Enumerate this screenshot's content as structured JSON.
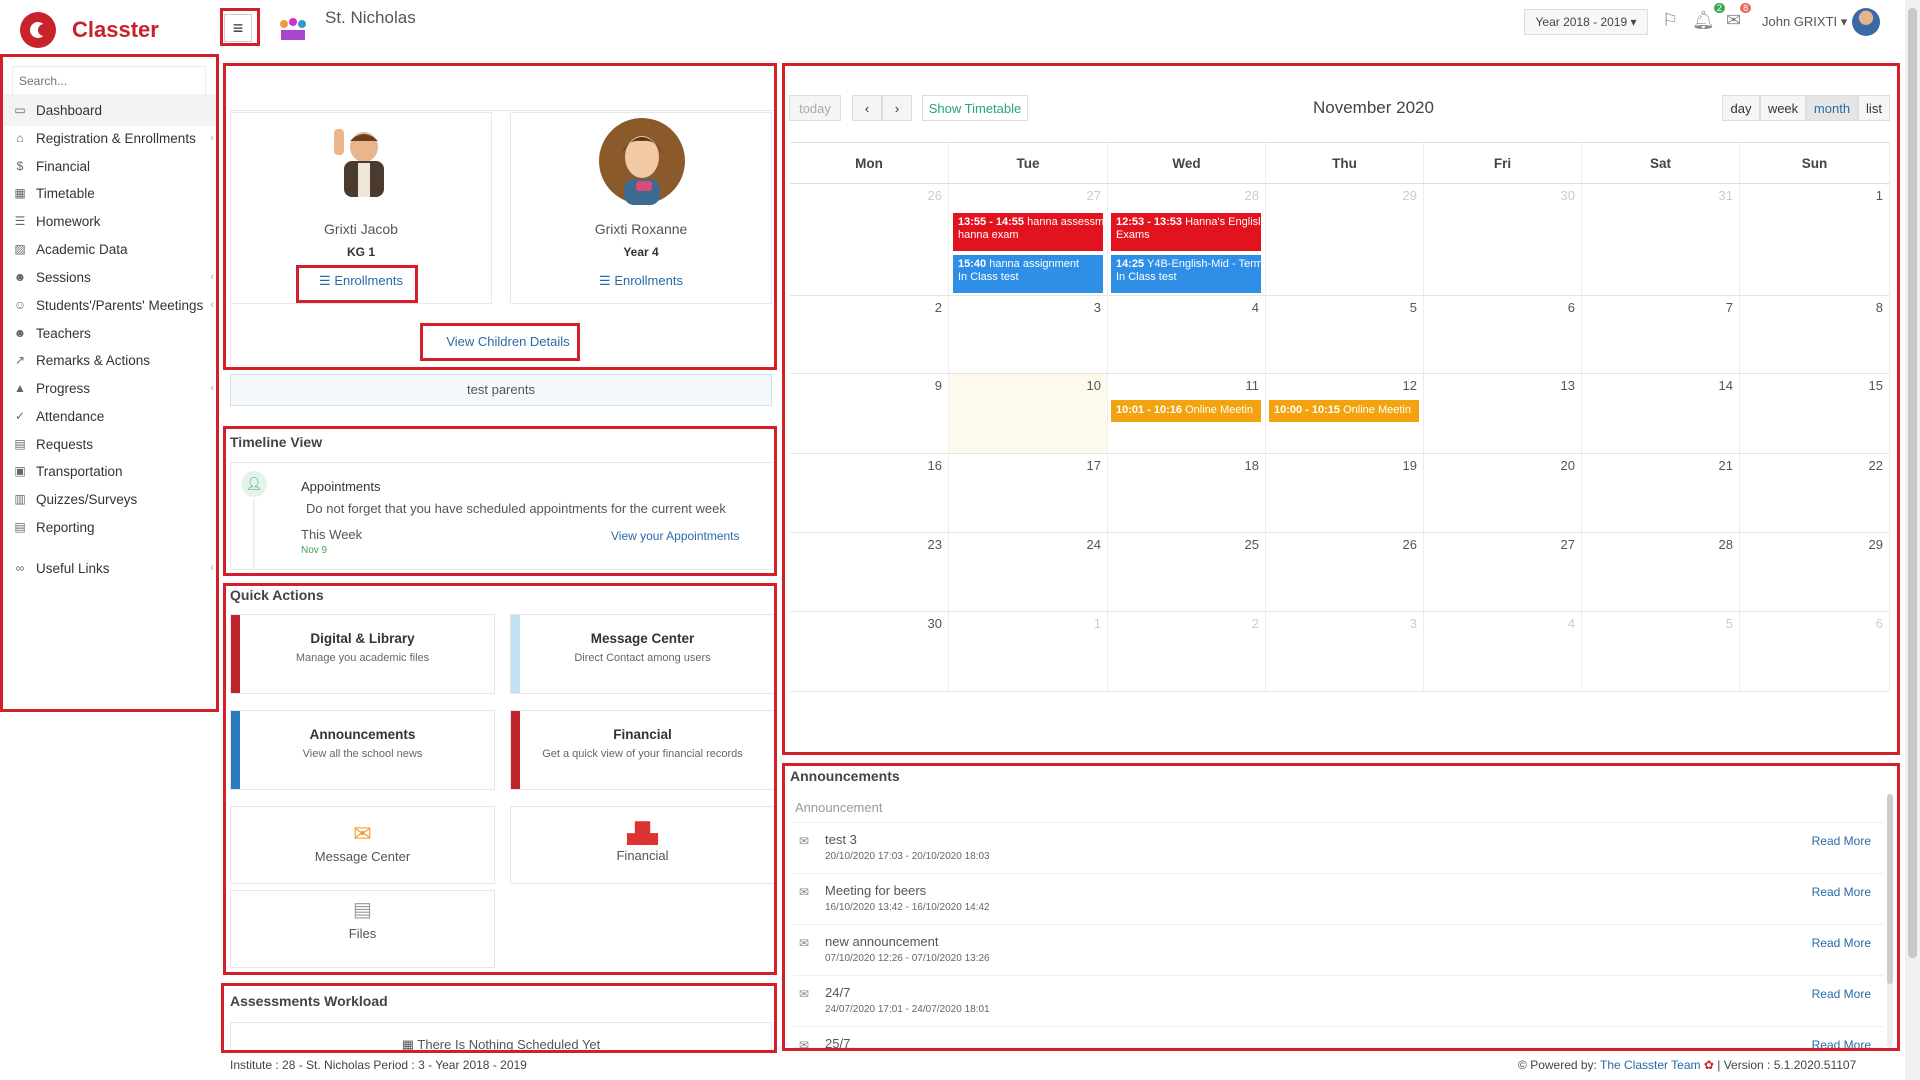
{
  "app": {
    "name": "Classter",
    "school": "St. Nicholas",
    "year": "Year 2018 - 2019 ▾",
    "user": "John GRIXTI ▾",
    "notif_count": "2",
    "mail_count": "8"
  },
  "search": {
    "placeholder": "Search..."
  },
  "sidebar": {
    "items": [
      {
        "label": "Dashboard",
        "icon": "monitor-icon"
      },
      {
        "label": "Registration & Enrollments",
        "icon": "bank-icon"
      },
      {
        "label": "Financial",
        "icon": "money-icon"
      },
      {
        "label": "Timetable",
        "icon": "calendar-icon"
      },
      {
        "label": "Homework",
        "icon": "list-icon"
      },
      {
        "label": "Academic Data",
        "icon": "chart-icon"
      },
      {
        "label": "Sessions",
        "icon": "users-icon"
      },
      {
        "label": "Students'/Parents' Meetings",
        "icon": "meeting-icon"
      },
      {
        "label": "Teachers",
        "icon": "teachers-icon"
      },
      {
        "label": "Remarks & Actions",
        "icon": "trend-icon"
      },
      {
        "label": "Progress",
        "icon": "graduation-icon"
      },
      {
        "label": "Attendance",
        "icon": "attendance-icon"
      },
      {
        "label": "Requests",
        "icon": "document-icon"
      },
      {
        "label": "Transportation",
        "icon": "bus-icon"
      },
      {
        "label": "Quizzes/Surveys",
        "icon": "quiz-icon"
      },
      {
        "label": "Reporting",
        "icon": "printer-icon"
      },
      {
        "label": "Useful Links",
        "icon": "link-icon"
      }
    ]
  },
  "children": [
    {
      "name": "Grixti Jacob",
      "grade": "KG 1",
      "link": "☰ Enrollments"
    },
    {
      "name": "Grixti Roxanne",
      "grade": "Year 4",
      "link": "☰ Enrollments"
    }
  ],
  "view_children": "View Children Details",
  "parents_label": "test parents",
  "timeline": {
    "title": "Timeline View",
    "heading": "Appointments",
    "text": "Do not forget that you have scheduled appointments for the current week",
    "week": "This Week",
    "date": "Nov 9",
    "link": "View your Appointments"
  },
  "quick": {
    "title": "Quick Actions",
    "cards": [
      {
        "title": "Digital & Library",
        "sub": "Manage you academic files"
      },
      {
        "title": "Message Center",
        "sub": "Direct Contact among users"
      },
      {
        "title": "Announcements",
        "sub": "View all the school news"
      },
      {
        "title": "Financial",
        "sub": "Get a quick view of your financial records"
      }
    ],
    "tiles": [
      "Message Center",
      "Financial",
      "Files"
    ]
  },
  "workload": {
    "title": "Assessments Workload",
    "empty": "There Is Nothing Scheduled Yet"
  },
  "calendar": {
    "title": "November 2020",
    "today": "today",
    "prev": "‹",
    "next": "›",
    "show_tt": "Show Timetable",
    "views": [
      "day",
      "week",
      "month",
      "list"
    ],
    "days": [
      "Mon",
      "Tue",
      "Wed",
      "Thu",
      "Fri",
      "Sat",
      "Sun"
    ],
    "weeks": [
      [
        "26",
        "27",
        "28",
        "29",
        "30",
        "31",
        "1"
      ],
      [
        "2",
        "3",
        "4",
        "5",
        "6",
        "7",
        "8"
      ],
      [
        "9",
        "10",
        "11",
        "12",
        "13",
        "14",
        "15"
      ],
      [
        "16",
        "17",
        "18",
        "19",
        "20",
        "21",
        "22"
      ],
      [
        "23",
        "24",
        "25",
        "26",
        "27",
        "28",
        "29"
      ],
      [
        "30",
        "1",
        "2",
        "3",
        "4",
        "5",
        "6"
      ]
    ],
    "events": [
      {
        "time": "13:55 - 14:55",
        "text": "hanna assessm",
        "line2": "hanna exam",
        "color": "#e2131f"
      },
      {
        "time": "15:40",
        "text": "hanna assignment",
        "line2": "In Class test",
        "color": "#2f8fe6"
      },
      {
        "time": "12:53 - 13:53",
        "text": "Hanna's Englisl",
        "line2": "Exams",
        "color": "#e2131f"
      },
      {
        "time": "14:25",
        "text": "Y4B-English-Mid - Term",
        "line2": "In Class test",
        "color": "#2f8fe6"
      },
      {
        "time": "10:01 - 10:16",
        "text": "Online Meetin",
        "line2": "",
        "color": "#f2a30f"
      },
      {
        "time": "10:00 - 10:15",
        "text": "Online Meetin",
        "line2": "",
        "color": "#f2a30f"
      }
    ]
  },
  "announcements": {
    "title": "Announcements",
    "subtitle": "Announcement",
    "read_more": "Read More",
    "items": [
      {
        "title": "test 3",
        "date": "20/10/2020 17:03 - 20/10/2020 18:03"
      },
      {
        "title": "Meeting for beers",
        "date": "16/10/2020 13:42 - 16/10/2020 14:42"
      },
      {
        "title": "new announcement",
        "date": "07/10/2020 12:26 - 07/10/2020 13:26"
      },
      {
        "title": "24/7",
        "date": "24/07/2020 17:01 - 24/07/2020 18:01"
      },
      {
        "title": "25/7",
        "date": ""
      }
    ]
  },
  "footer": {
    "left": "Institute : 28 - St. Nicholas  Period : 3 - Year 2018 - 2019",
    "powered": "Powered by:",
    "team": "The Classter Team",
    "version": "| Version : 5.1.2020.51107"
  }
}
